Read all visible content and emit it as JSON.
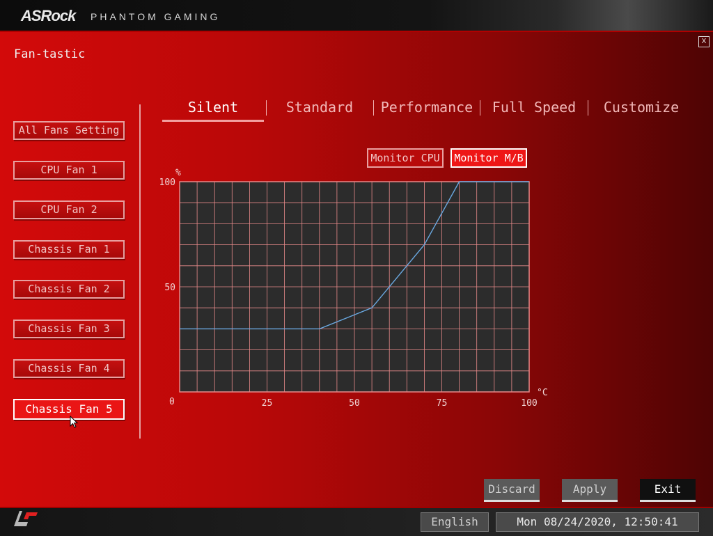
{
  "header": {
    "brand": "ASRock",
    "brand_sub": "PHANTOM GAMING",
    "close_label": "X"
  },
  "page": {
    "title": "Fan-tastic"
  },
  "fans": [
    {
      "label": "All Fans Setting"
    },
    {
      "label": "CPU Fan 1"
    },
    {
      "label": "CPU Fan 2"
    },
    {
      "label": "Chassis Fan 1"
    },
    {
      "label": "Chassis Fan 2"
    },
    {
      "label": "Chassis Fan 3"
    },
    {
      "label": "Chassis Fan 4"
    },
    {
      "label": "Chassis Fan 5",
      "selected": true
    }
  ],
  "tabs": [
    {
      "label": "Silent",
      "active": true
    },
    {
      "label": "Standard"
    },
    {
      "label": "Performance"
    },
    {
      "label": "Full Speed"
    },
    {
      "label": "Customize"
    }
  ],
  "monitor": {
    "cpu_label": "Monitor CPU",
    "mb_label": "Monitor M/B",
    "active": "mb"
  },
  "chart_data": {
    "type": "line",
    "x_unit": "°C",
    "y_unit": "%",
    "xlim": [
      0,
      100
    ],
    "ylim": [
      0,
      100
    ],
    "x_ticks": [
      0,
      25,
      50,
      75,
      100
    ],
    "y_ticks": [
      0,
      50,
      100
    ],
    "x_tick_labels": [
      "25",
      "50",
      "75",
      "100"
    ],
    "y_tick_labels": [
      "100",
      "50",
      "0"
    ],
    "grid": true,
    "series": [
      {
        "x": [
          0,
          40,
          55,
          70,
          80,
          100
        ],
        "y": [
          30,
          30,
          40,
          70,
          100,
          100
        ]
      }
    ]
  },
  "actions": {
    "discard": "Discard",
    "apply": "Apply",
    "exit": "Exit"
  },
  "footer": {
    "language": "English",
    "datetime": "Mon 08/24/2020, 12:50:41"
  },
  "colors": {
    "accent": "#e01010",
    "chart_bg": "#2c2c2c",
    "grid": "#e88a8a",
    "curve": "#6aa8e0"
  }
}
